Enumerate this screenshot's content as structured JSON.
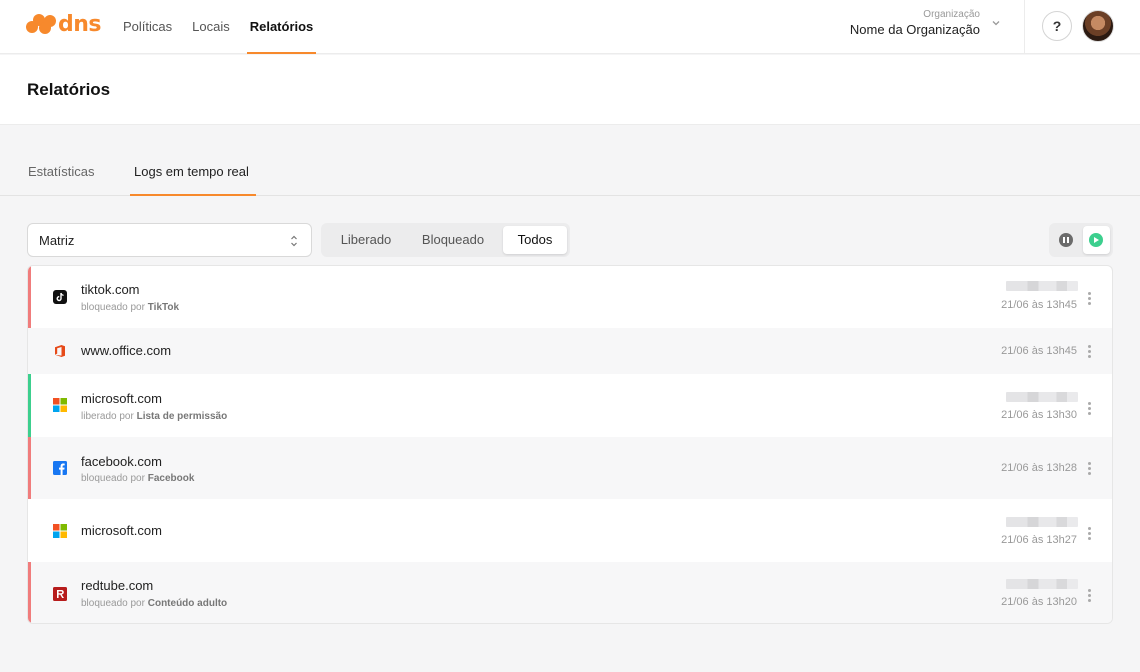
{
  "brand": {
    "name": "dns",
    "color": "#f7892c"
  },
  "nav": {
    "items": [
      {
        "label": "Políticas",
        "active": false
      },
      {
        "label": "Locais",
        "active": false
      },
      {
        "label": "Relatórios",
        "active": true
      }
    ]
  },
  "org": {
    "label": "Organização",
    "name": "Nome da Organização"
  },
  "help": {
    "label": "?"
  },
  "page": {
    "title": "Relatórios"
  },
  "tabs": [
    {
      "label": "Estatísticas",
      "active": false
    },
    {
      "label": "Logs em tempo real",
      "active": true
    }
  ],
  "filters": {
    "location_select": {
      "value": "Matriz"
    },
    "status_segments": [
      {
        "label": "Liberado",
        "selected": false
      },
      {
        "label": "Bloqueado",
        "selected": false
      },
      {
        "label": "Todos",
        "selected": true
      }
    ],
    "playback": {
      "paused": false,
      "playing": true
    }
  },
  "status_colors": {
    "blocked": "#f07c7c",
    "allowed": "#3ccf8e"
  },
  "logs": [
    {
      "domain": "tiktok.com",
      "icon": "tiktok-icon",
      "status": "blocked",
      "sub_prefix": "bloqueado por",
      "sub_by": "TikTok",
      "time": "21/06 às 13h45",
      "has_blurred": true
    },
    {
      "domain": "www.office.com",
      "icon": "office-icon",
      "status": "none",
      "sub_prefix": "",
      "sub_by": "",
      "time": "21/06 às 13h45",
      "has_blurred": false
    },
    {
      "domain": "microsoft.com",
      "icon": "microsoft-icon",
      "status": "allowed",
      "sub_prefix": "liberado por",
      "sub_by": "Lista de permissão",
      "time": "21/06 às 13h30",
      "has_blurred": true
    },
    {
      "domain": "facebook.com",
      "icon": "facebook-icon",
      "status": "blocked",
      "sub_prefix": "bloqueado por",
      "sub_by": "Facebook",
      "time": "21/06 às 13h28",
      "has_blurred": false
    },
    {
      "domain": "microsoft.com",
      "icon": "microsoft-icon",
      "status": "none",
      "sub_prefix": "",
      "sub_by": "",
      "time": "21/06 às 13h27",
      "has_blurred": true
    },
    {
      "domain": "redtube.com",
      "icon": "redtube-icon",
      "status": "blocked",
      "sub_prefix": "bloqueado por",
      "sub_by": "Conteúdo adulto",
      "time": "21/06 às 13h20",
      "has_blurred": true
    }
  ]
}
